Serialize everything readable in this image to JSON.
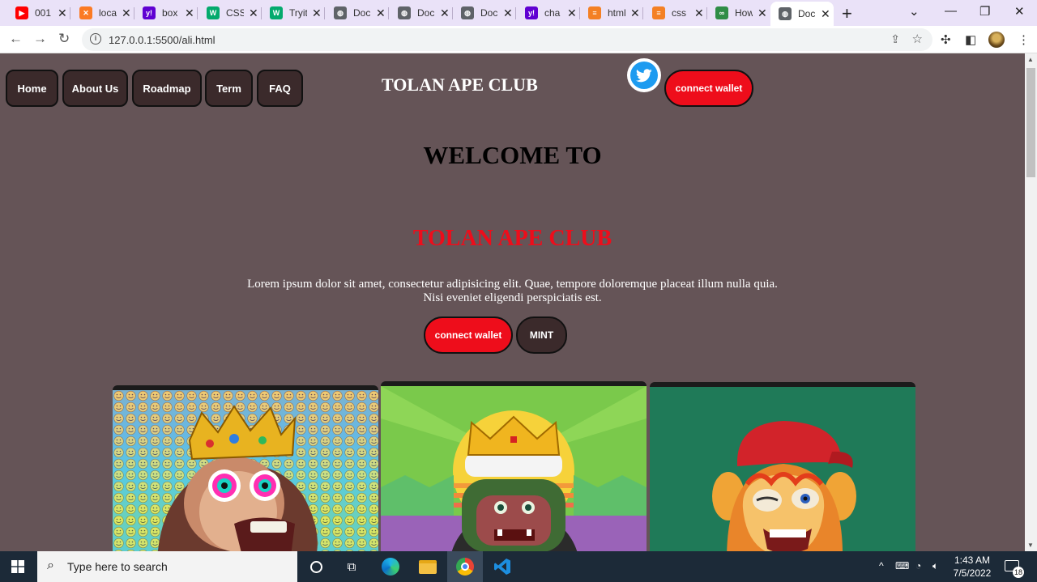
{
  "browser": {
    "tabs": [
      {
        "title": "001",
        "icon": "youtube-icon",
        "color": "#ff0000"
      },
      {
        "title": "localhost",
        "icon": "xampp-icon",
        "color": "#fb7a24"
      },
      {
        "title": "box",
        "icon": "yahoo-icon",
        "color": "#6001d2"
      },
      {
        "title": "CSS",
        "icon": "w3schools-icon",
        "color": "#04aa6d"
      },
      {
        "title": "Tryit",
        "icon": "w3schools-icon",
        "color": "#04aa6d"
      },
      {
        "title": "Doc",
        "icon": "globe-icon",
        "color": "#5f6368"
      },
      {
        "title": "Doc",
        "icon": "globe-icon",
        "color": "#5f6368"
      },
      {
        "title": "Doc",
        "icon": "globe-icon",
        "color": "#5f6368"
      },
      {
        "title": "cha",
        "icon": "yahoo-icon",
        "color": "#6001d2"
      },
      {
        "title": "html",
        "icon": "stackoverflow-icon",
        "color": "#f48024"
      },
      {
        "title": "css",
        "icon": "stackoverflow-icon",
        "color": "#f48024"
      },
      {
        "title": "How",
        "icon": "geeksforgeeks-icon",
        "color": "#2f8d46"
      },
      {
        "title": "Doc",
        "icon": "globe-icon",
        "color": "#5f6368",
        "active": true
      }
    ],
    "url": "127.0.0.1:5500/ali.html"
  },
  "page": {
    "nav": [
      "Home",
      "About Us",
      "Roadmap",
      "Term",
      "FAQ"
    ],
    "brand": "TOLAN APE CLUB",
    "header_connect": "connect wallet",
    "welcome": "WELCOME TO",
    "hero_title": "TOLAN APE CLUB",
    "hero_text_line1": "Lorem ipsum dolor sit amet, consectetur adipisicing elit. Quae, tempore doloremque placeat illum nulla quia.",
    "hero_text_line2": "Nisi eveniet eligendi perspiciatis est.",
    "hero_connect": "connect wallet",
    "mint": "MINT",
    "colors": {
      "background": "#655457",
      "accent": "#ee0d1b",
      "button_dark": "#3b2a2b",
      "twitter": "#1d9bf0"
    }
  },
  "taskbar": {
    "search_placeholder": "Type here to search",
    "time": "1:43 AM",
    "date": "7/5/2022",
    "notifications": "18"
  }
}
